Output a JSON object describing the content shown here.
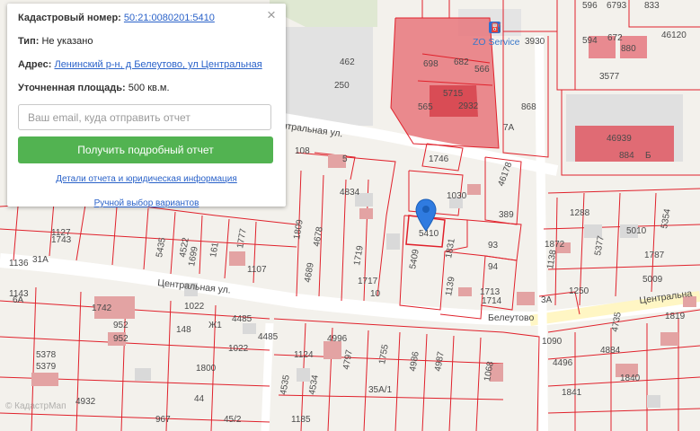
{
  "panel": {
    "cadastral_label": "Кадастровый номер:",
    "cadastral_value": "50:21:0080201:5410",
    "type_label": "Тип:",
    "type_value": "Не указано",
    "address_label": "Адрес:",
    "address_value": "Ленинский р-н, д Белеутово, ул Центральная",
    "area_label": "Уточненная площадь:",
    "area_value": "500 кв.м.",
    "email_placeholder": "Ваш email, куда отправить отчет",
    "cta_label": "Получить подробный отчет",
    "details_link": "Детали отчета и юридическая информация",
    "manual_link": "Ручной выбор вариантов",
    "close_glyph": "×"
  },
  "map": {
    "streets": [
      "Центральная ул.",
      "Центральная ул.",
      "Центральна"
    ],
    "village": "Белеутово",
    "poi": "ZO Service",
    "attribution": "© КадастрМап",
    "colors": {
      "parcel": "#e0212b",
      "parcel_fill": "#e8777c",
      "building": "#e3a3a3",
      "road": "#fff6c4"
    },
    "labels": [
      "596",
      "6793",
      "833",
      "46120",
      "594",
      "672",
      "880",
      "3930",
      "3577",
      "462",
      "250",
      "698",
      "682",
      "566",
      "565",
      "5715",
      "2932",
      "868",
      "7А",
      "46939",
      "884",
      "Б",
      "108",
      "5",
      "1746",
      "4834",
      "1030",
      "46178",
      "389",
      "1288",
      "5354",
      "5010",
      "1787",
      "5409",
      "1831",
      "93",
      "94",
      "1872",
      "1138",
      "5377",
      "1250",
      "5009",
      "1713",
      "1714",
      "1743",
      "1127",
      "1136",
      "31А",
      "6А",
      "1742",
      "952",
      "148",
      "1022",
      "4485",
      "1022",
      "1800",
      "4996",
      "1124",
      "4797",
      "1755",
      "4986",
      "4987",
      "5378",
      "5379",
      "4932",
      "967",
      "1185",
      "4535",
      "4534",
      "35А/1",
      "1068",
      "1090",
      "4884",
      "4496",
      "1841",
      "1840",
      "1819",
      "4735",
      "5435",
      "4522",
      "1699",
      "161",
      "1777",
      "1107",
      "1809",
      "1719",
      "4678",
      "1717",
      "1143",
      "10",
      "4689",
      "1139",
      "45/2",
      "44",
      "Ж1",
      "3А"
    ]
  }
}
